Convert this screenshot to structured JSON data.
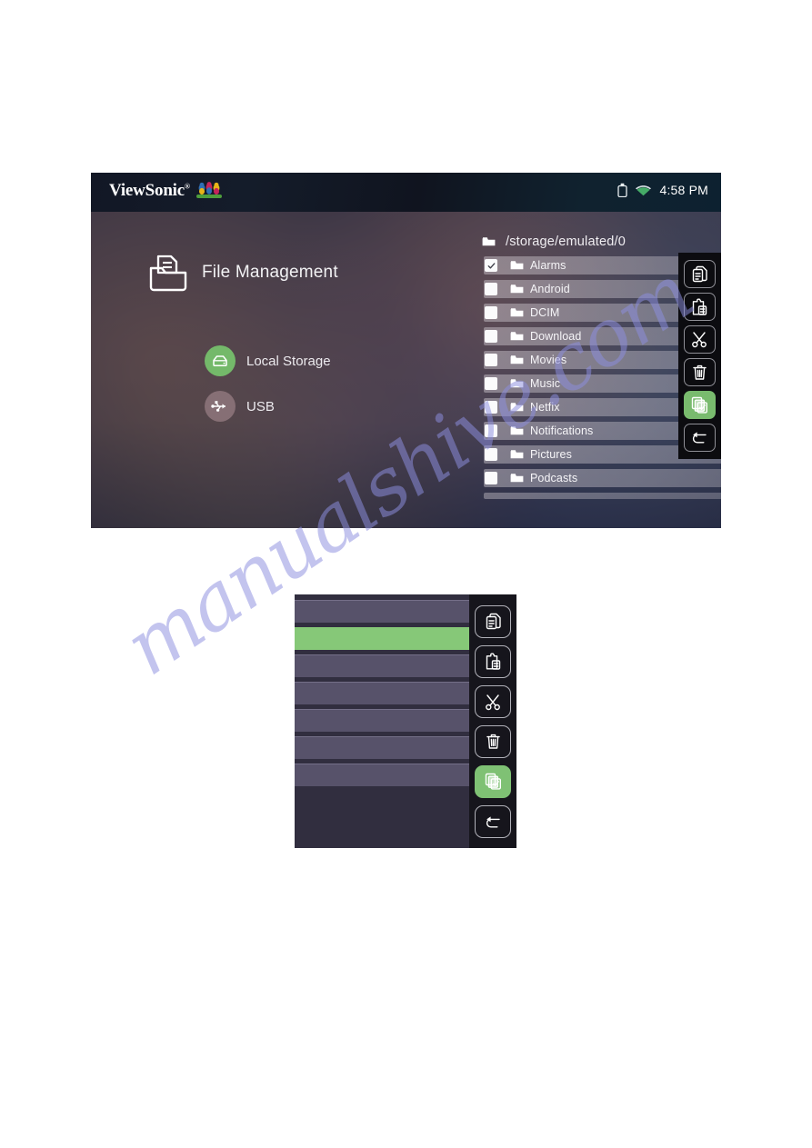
{
  "page": {
    "watermark": "manualshive.com"
  },
  "device": {
    "statusbar": {
      "brand": "ViewSonic",
      "brand_mark": "®",
      "birds_icon": "viewsonic-birds-icon",
      "usb_icon": "usb-storage-icon",
      "wifi_icon": "wifi-icon",
      "time": "4:58 PM"
    },
    "app": {
      "icon": "file-management-icon",
      "title": "File Management"
    },
    "sources": [
      {
        "label": "Local Storage",
        "icon": "hard-drive-icon",
        "active": true,
        "color": "#74b96a"
      },
      {
        "label": "USB",
        "icon": "usb-icon",
        "active": false,
        "color": "#b4969b"
      }
    ],
    "browser": {
      "path_icon": "folder-icon",
      "path": "/storage/emulated/0",
      "rows": [
        {
          "name": "Alarms",
          "checked": true
        },
        {
          "name": "Android",
          "checked": false
        },
        {
          "name": "DCIM",
          "checked": false
        },
        {
          "name": "Download",
          "checked": false
        },
        {
          "name": "Movies",
          "checked": false
        },
        {
          "name": "Music",
          "checked": false
        },
        {
          "name": "Netfix",
          "checked": false
        },
        {
          "name": "Notifications",
          "checked": false
        },
        {
          "name": "Pictures",
          "checked": false
        },
        {
          "name": "Podcasts",
          "checked": false
        }
      ]
    },
    "toolbar": {
      "buttons": [
        {
          "name": "copy-button",
          "icon": "copy-icon",
          "active": false
        },
        {
          "name": "paste-button",
          "icon": "paste-icon",
          "active": false
        },
        {
          "name": "cut-button",
          "icon": "scissors-icon",
          "active": false
        },
        {
          "name": "delete-button",
          "icon": "trash-icon",
          "active": false
        },
        {
          "name": "select-all-button",
          "icon": "select-all-icon",
          "active": true
        },
        {
          "name": "back-button",
          "icon": "return-icon",
          "active": false
        }
      ]
    }
  },
  "detail": {
    "rows": [
      {
        "selected": false
      },
      {
        "selected": true
      },
      {
        "selected": false
      },
      {
        "selected": false
      },
      {
        "selected": false
      },
      {
        "selected": false
      },
      {
        "selected": false
      }
    ],
    "toolbar": {
      "buttons": [
        {
          "name": "copy-button",
          "icon": "copy-icon",
          "active": false
        },
        {
          "name": "paste-button",
          "icon": "paste-icon",
          "active": false
        },
        {
          "name": "cut-button",
          "icon": "scissors-icon",
          "active": false
        },
        {
          "name": "delete-button",
          "icon": "trash-icon",
          "active": false
        },
        {
          "name": "select-all-button",
          "icon": "select-all-icon",
          "active": true
        },
        {
          "name": "back-button",
          "icon": "return-icon",
          "active": false
        }
      ]
    },
    "accent_color": "#86c878"
  }
}
